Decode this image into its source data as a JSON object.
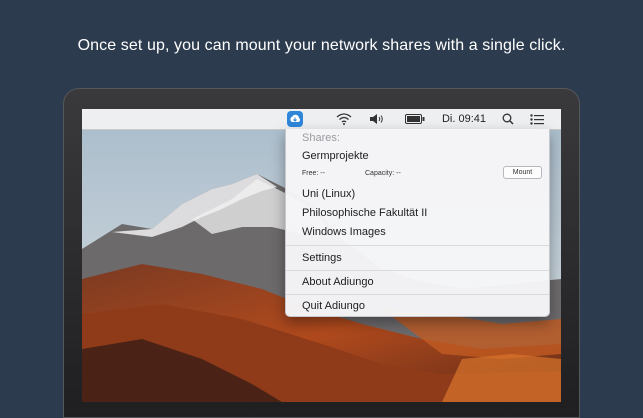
{
  "headline": "Once set up, you can mount your network shares with a single click.",
  "menubar": {
    "clock": "Di. 09:41",
    "icons": [
      "adiungo-app-icon",
      "wifi-icon",
      "volume-icon",
      "battery-icon",
      "search-icon",
      "list-icon"
    ]
  },
  "menu": {
    "shares_header": "Shares:",
    "share_selected": "Germprojekte",
    "free_label": "Free: --",
    "capacity_label": "Capacity: --",
    "mount_button": "Mount",
    "shares": [
      "Uni (Linux)",
      "Philosophische Fakultät II",
      "Windows Images"
    ],
    "settings": "Settings",
    "about": "About Adiungo",
    "quit": "Quit Adiungo"
  },
  "colors": {
    "background": "#2d3b4f",
    "app_icon": "#2f86d9"
  }
}
